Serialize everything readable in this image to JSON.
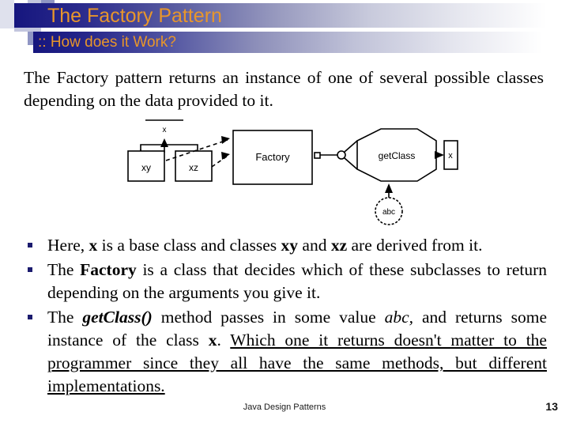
{
  "slide": {
    "title": "The Factory Pattern",
    "subtitle": ":: How does it Work?",
    "accent_color": "#e8962b",
    "bar_color": "#16167e",
    "intro": "The Factory pattern returns an instance of one of several possible classes depending on the data provided to it.",
    "bullets": [
      {
        "id": "bullet-1",
        "parts": [
          {
            "text": "Here, ",
            "style": "normal"
          },
          {
            "text": "x",
            "style": "bold"
          },
          {
            "text": " is a base class and classes ",
            "style": "normal"
          },
          {
            "text": "xy",
            "style": "bold"
          },
          {
            "text": " and ",
            "style": "normal"
          },
          {
            "text": "xz",
            "style": "bold"
          },
          {
            "text": " are derived from it.",
            "style": "normal"
          }
        ]
      },
      {
        "id": "bullet-2",
        "parts": [
          {
            "text": "The ",
            "style": "normal"
          },
          {
            "text": "Factory",
            "style": "bold"
          },
          {
            "text": " is a class that decides which of these subclasses to return depending on the arguments you give it.",
            "style": "normal"
          }
        ]
      },
      {
        "id": "bullet-3",
        "parts": [
          {
            "text": "The ",
            "style": "normal"
          },
          {
            "text": "getClass()",
            "style": "bold-italic"
          },
          {
            "text": " method passes in some value ",
            "style": "normal"
          },
          {
            "text": "abc,",
            "style": "italic"
          },
          {
            "text": " and returns some instance of the class ",
            "style": "normal"
          },
          {
            "text": "x",
            "style": "bold"
          },
          {
            "text": ". ",
            "style": "normal"
          },
          {
            "text": "Which one it returns doesn't matter to the programmer since they all have the same methods, but different implementations.",
            "style": "underline"
          }
        ]
      }
    ],
    "footer": "Java Design Patterns",
    "page_number": "13"
  },
  "diagram": {
    "nodes": {
      "base_class": "x",
      "subclass_left": "xy",
      "subclass_right": "xz",
      "factory": "Factory",
      "method": "getClass",
      "input": "abc",
      "output": "x"
    }
  }
}
